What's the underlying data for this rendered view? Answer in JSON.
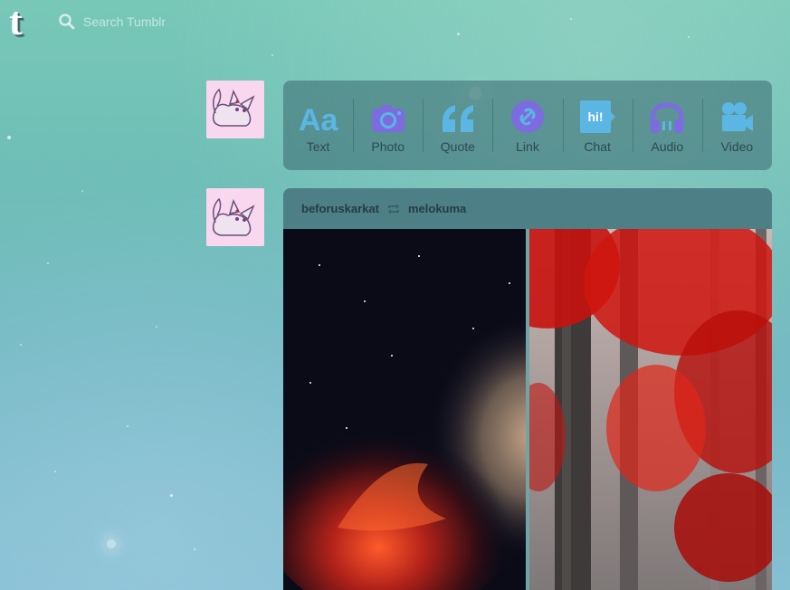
{
  "app": {
    "logo_text": "t",
    "search_placeholder": "Search Tumblr"
  },
  "post_types": [
    {
      "label": "Text",
      "icon": "text-icon",
      "color": "#5bb6e4"
    },
    {
      "label": "Photo",
      "icon": "camera-icon",
      "color": "#7d6be0"
    },
    {
      "label": "Quote",
      "icon": "quote-icon",
      "color": "#5bb6e4"
    },
    {
      "label": "Link",
      "icon": "link-icon",
      "color": "#7d6be0"
    },
    {
      "label": "Chat",
      "icon": "chat-icon",
      "color": "#5bb6e4"
    },
    {
      "label": "Audio",
      "icon": "headphones-icon",
      "color": "#7d6be0"
    },
    {
      "label": "Video",
      "icon": "video-camera-icon",
      "color": "#5bb6e4"
    }
  ],
  "chat_icon_text": "hi!",
  "post": {
    "reblogger": "beforuskarkat",
    "source": "melokuma",
    "photos": [
      {
        "description": "nebula-photo"
      },
      {
        "description": "red-forest-photo"
      }
    ]
  }
}
